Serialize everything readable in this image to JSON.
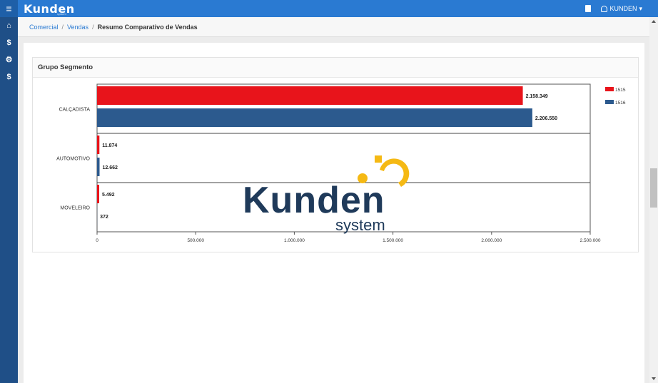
{
  "app": {
    "logo": "Kunden",
    "logo_sub": "system"
  },
  "topbar": {
    "menu_icon": "hamburger-icon",
    "user_label": "KUNDEN"
  },
  "sidebar": {
    "items": [
      {
        "icon": "home-icon",
        "glyph": "⌂"
      },
      {
        "icon": "dollar-icon",
        "glyph": "$"
      },
      {
        "icon": "gears-icon",
        "glyph": "⚙"
      },
      {
        "icon": "dollar-icon",
        "glyph": "$"
      }
    ]
  },
  "breadcrumb": {
    "items": [
      "Comercial",
      "Vendas"
    ],
    "current": "Resumo Comparativo de Vendas"
  },
  "panel": {
    "title": "Grupo Segmento"
  },
  "watermark": {
    "brand": "Kunden",
    "tagline": "system"
  },
  "chart_data": {
    "type": "bar",
    "orientation": "horizontal",
    "categories": [
      "CALÇADISTA",
      "AUTOMOTIVO",
      "MOVELEIRO"
    ],
    "series": [
      {
        "name": "1515",
        "color": "#e8141b",
        "values": [
          2158349,
          11874,
          5492
        ],
        "labels": [
          "2.158.349",
          "11.874",
          "5.492"
        ]
      },
      {
        "name": "1516",
        "color": "#2c5a8e",
        "values": [
          2206550,
          12662,
          372
        ],
        "labels": [
          "2.206.550",
          "12.662",
          "372"
        ]
      }
    ],
    "xlim": [
      0,
      2500000
    ],
    "xticks": [
      0,
      500000,
      1000000,
      1500000,
      2000000,
      2500000
    ],
    "xtick_labels": [
      "0",
      "500.000",
      "1.000.000",
      "1.500.000",
      "2.000.000",
      "2.500.000"
    ],
    "legend": "top-right"
  }
}
